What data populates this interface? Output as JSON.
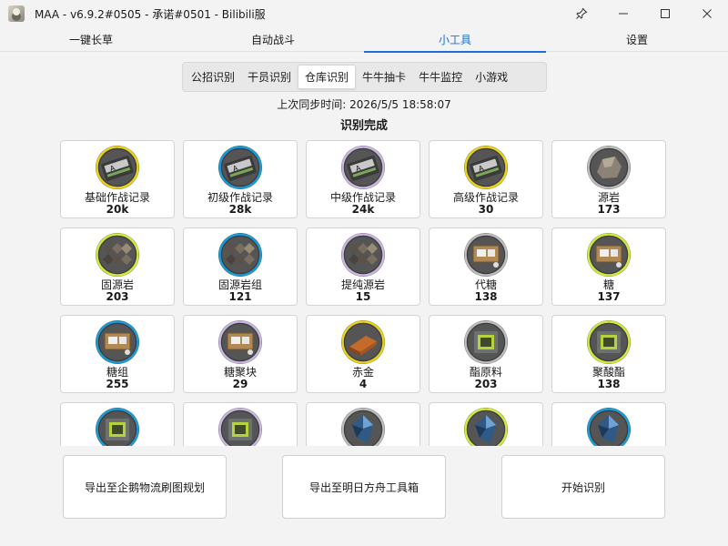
{
  "window": {
    "title": "MAA - v6.9.2#0505 - 承诺#0501 - Bilibili服"
  },
  "tabs": [
    {
      "label": "一键长草"
    },
    {
      "label": "自动战斗"
    },
    {
      "label": "小工具",
      "active": true
    },
    {
      "label": "设置"
    }
  ],
  "subtabs": [
    {
      "label": "公招识别"
    },
    {
      "label": "干员识别"
    },
    {
      "label": "仓库识别",
      "active": true
    },
    {
      "label": "牛牛抽卡"
    },
    {
      "label": "牛牛监控"
    },
    {
      "label": "小游戏"
    }
  ],
  "sync_text": "上次同步时间: 2026/5/5 18:58:07",
  "status_text": "识别完成",
  "colors": {
    "accent": "#1f6fd6",
    "rarity_yellow": "#e8d21c",
    "rarity_blue": "#1b9ad6",
    "rarity_purple": "#c9b7e0",
    "rarity_green": "#d2ea3a",
    "rarity_gray": "#bcbcbc"
  },
  "items": [
    {
      "name": "基础作战记录",
      "count": "20k",
      "icon": "battle-record-basic-icon",
      "rarity": "yellow"
    },
    {
      "name": "初级作战记录",
      "count": "28k",
      "icon": "battle-record-primary-icon",
      "rarity": "blue"
    },
    {
      "name": "中级作战记录",
      "count": "24k",
      "icon": "battle-record-intermediate-icon",
      "rarity": "purple"
    },
    {
      "name": "高级作战记录",
      "count": "30",
      "icon": "battle-record-advanced-icon",
      "rarity": "yellow"
    },
    {
      "name": "源岩",
      "count": "173",
      "icon": "orirock-icon",
      "rarity": "gray"
    },
    {
      "name": "固源岩",
      "count": "203",
      "icon": "orirock-cube-icon",
      "rarity": "green"
    },
    {
      "name": "固源岩组",
      "count": "121",
      "icon": "orirock-cluster-icon",
      "rarity": "blue"
    },
    {
      "name": "提纯源岩",
      "count": "15",
      "icon": "orirock-concentration-icon",
      "rarity": "purple"
    },
    {
      "name": "代糖",
      "count": "138",
      "icon": "sugar-substitute-icon",
      "rarity": "gray"
    },
    {
      "name": "糖",
      "count": "137",
      "icon": "sugar-icon",
      "rarity": "green"
    },
    {
      "name": "糖组",
      "count": "255",
      "icon": "sugar-pack-icon",
      "rarity": "blue"
    },
    {
      "name": "糖聚块",
      "count": "29",
      "icon": "sugar-lump-icon",
      "rarity": "purple"
    },
    {
      "name": "赤金",
      "count": "4",
      "icon": "pure-gold-icon",
      "rarity": "yellow"
    },
    {
      "name": "酯原料",
      "count": "203",
      "icon": "ester-icon",
      "rarity": "gray"
    },
    {
      "name": "聚酸酯",
      "count": "138",
      "icon": "polyester-icon",
      "rarity": "green"
    },
    {
      "name": "",
      "count": "",
      "icon": "polyester-pack-icon",
      "rarity": "blue"
    },
    {
      "name": "",
      "count": "",
      "icon": "polyester-lump-icon",
      "rarity": "purple"
    },
    {
      "name": "",
      "count": "",
      "icon": "oriron-shard-icon",
      "rarity": "gray"
    },
    {
      "name": "",
      "count": "",
      "icon": "oriron-icon",
      "rarity": "green"
    },
    {
      "name": "",
      "count": "",
      "icon": "oriron-cluster-icon",
      "rarity": "blue"
    }
  ],
  "actions": [
    {
      "label": "导出至企鹅物流刷图规划"
    },
    {
      "label": "导出至明日方舟工具箱"
    },
    {
      "label": "开始识别"
    }
  ]
}
